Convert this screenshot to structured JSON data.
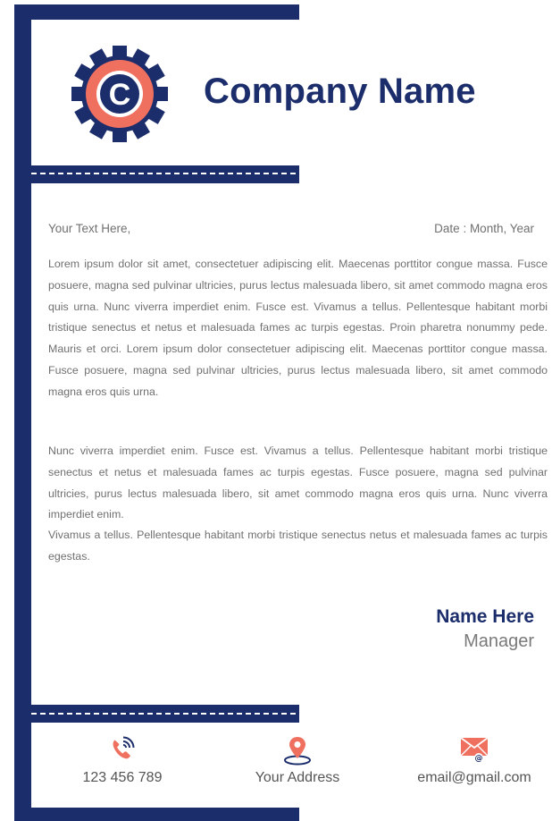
{
  "colors": {
    "navy": "#1c2d6b",
    "accent": "#f07060",
    "body_text": "#707070"
  },
  "header": {
    "logo_letter": "C",
    "company_name": "Company Name"
  },
  "letter": {
    "salutation": "Your Text Here,",
    "date": "Date : Month, Year",
    "paragraphs": [
      "Lorem ipsum dolor sit amet, consectetuer adipiscing elit. Maecenas porttitor congue massa. Fusce posuere, magna sed pulvinar ultricies, purus lectus malesuada libero, sit amet commodo magna eros quis urna. Nunc viverra imperdiet enim. Fusce est. Vivamus a tellus. Pellentesque habitant morbi tristique senectus et netus et malesuada fames ac turpis egestas. Proin pharetra nonummy pede. Mauris et orci. Lorem ipsum dolor consectetuer adipiscing elit. Maecenas porttitor congue massa. Fusce posuere, magna sed pulvinar ultricies, purus lectus malesuada libero, sit amet commodo magna eros quis urna.",
      "Nunc viverra imperdiet enim. Fusce est. Vivamus a tellus. Pellentesque habitant morbi tristique senectus et netus et malesuada fames ac turpis egestas. Fusce posuere, magna sed pulvinar ultricies, purus lectus malesuada libero, sit amet commodo magna eros quis urna. Nunc viverra imperdiet enim.",
      "Vivamus a tellus. Pellentesque habitant morbi tristique senectus netus et malesuada fames ac turpis egestas."
    ]
  },
  "signature": {
    "name": "Name Here",
    "title": "Manager"
  },
  "footer": {
    "phone": {
      "icon": "phone-icon",
      "text": "123 456 789"
    },
    "address": {
      "icon": "location-pin-icon",
      "text": "Your Address"
    },
    "email": {
      "icon": "envelope-icon",
      "text": "email@gmail.com"
    }
  }
}
